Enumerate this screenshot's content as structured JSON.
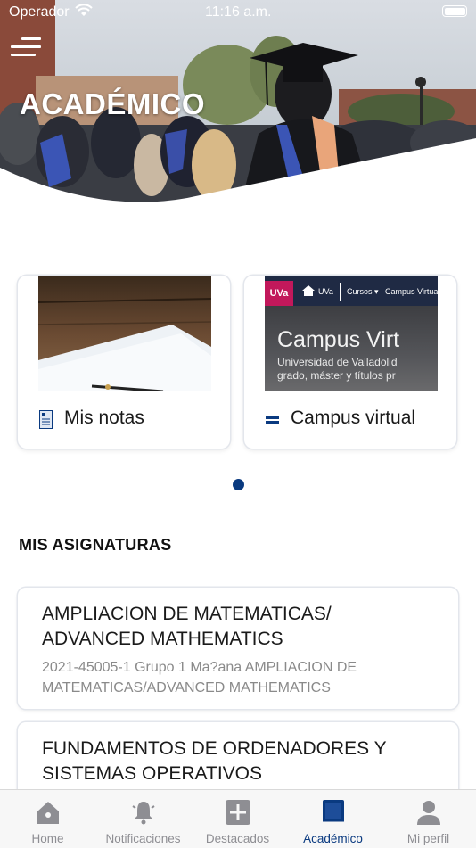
{
  "status_bar": {
    "carrier": "Operador",
    "time": "11:16 a.m."
  },
  "header": {
    "title": "ACADÉMICO",
    "menu_icon": "hamburger-menu-icon"
  },
  "cards": [
    {
      "label": "Mis notas",
      "icon": "document-icon"
    },
    {
      "label": "Campus virtual",
      "icon": "campus-icon",
      "image": {
        "badge": "UVa",
        "nav_home": "UVa",
        "nav_cursos": "Cursos ▾",
        "nav_campus": "Campus Virtual",
        "headline": "Campus Virt",
        "subline_1": "Universidad de Valladolid",
        "subline_2": "grado, máster y títulos pr"
      }
    }
  ],
  "pagination": {
    "pages": 1,
    "current": 1
  },
  "section": {
    "title": "MIS ASIGNATURAS"
  },
  "subjects": [
    {
      "name": "AMPLIACION DE MATEMATICAS/ ADVANCED MATHEMATICS",
      "detail": "2021-45005-1 Grupo 1 Ma?ana AMPLIACION DE MATEMATICAS/ADVANCED MATHEMATICS"
    },
    {
      "name": "FUNDAMENTOS DE ORDENADORES Y SISTEMAS OPERATIVOS",
      "detail": ""
    }
  ],
  "tabs": [
    {
      "label": "Home",
      "icon": "home-icon",
      "active": false
    },
    {
      "label": "Notificaciones",
      "icon": "bell-icon",
      "active": false
    },
    {
      "label": "Destacados",
      "icon": "plus-square-icon",
      "active": false
    },
    {
      "label": "Académico",
      "icon": "book-icon",
      "active": true
    },
    {
      "label": "Mi perfil",
      "icon": "person-icon",
      "active": false
    }
  ],
  "colors": {
    "accent": "#0a3a80",
    "inactive": "#8e8e93",
    "tabbar_bg": "#f7f7f7"
  }
}
